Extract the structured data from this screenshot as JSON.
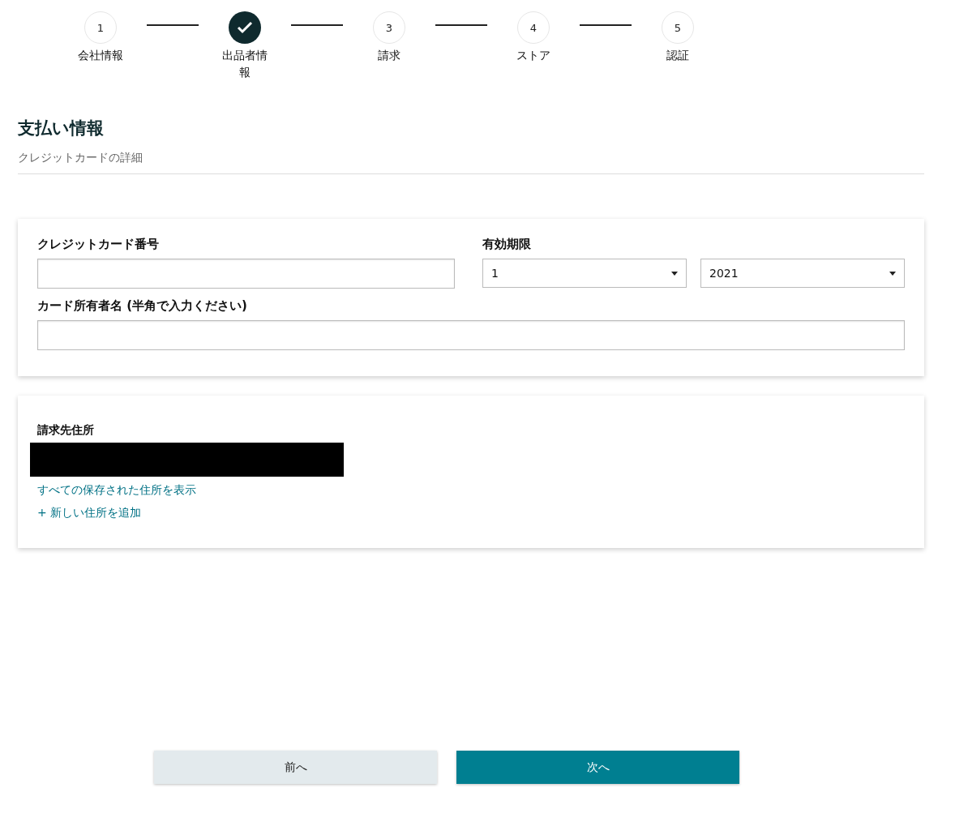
{
  "steps": [
    {
      "number": "1",
      "label": "会社情報",
      "completed": false
    },
    {
      "label": "出品者情報",
      "completed": true
    },
    {
      "number": "3",
      "label": "請求",
      "completed": false
    },
    {
      "number": "4",
      "label": "ストア",
      "completed": false
    },
    {
      "number": "5",
      "label": "認証",
      "completed": false
    }
  ],
  "section": {
    "title": "支払い情報",
    "subtitle": "クレジットカードの詳細"
  },
  "card_form": {
    "card_number_label": "クレジットカード番号",
    "expiry_label": "有効期限",
    "expiry_month": "1",
    "expiry_year": "2021",
    "holder_label": "カード所有者名 (半角で入力ください)"
  },
  "billing": {
    "label": "請求先住所",
    "address_redacted": true,
    "links": [
      "すべての保存された住所を表示",
      "+ 新しい住所を追加"
    ]
  },
  "buttons": [
    {
      "label": "前へ",
      "kind": "secondary"
    },
    {
      "label": "次へ",
      "kind": "primary"
    }
  ]
}
